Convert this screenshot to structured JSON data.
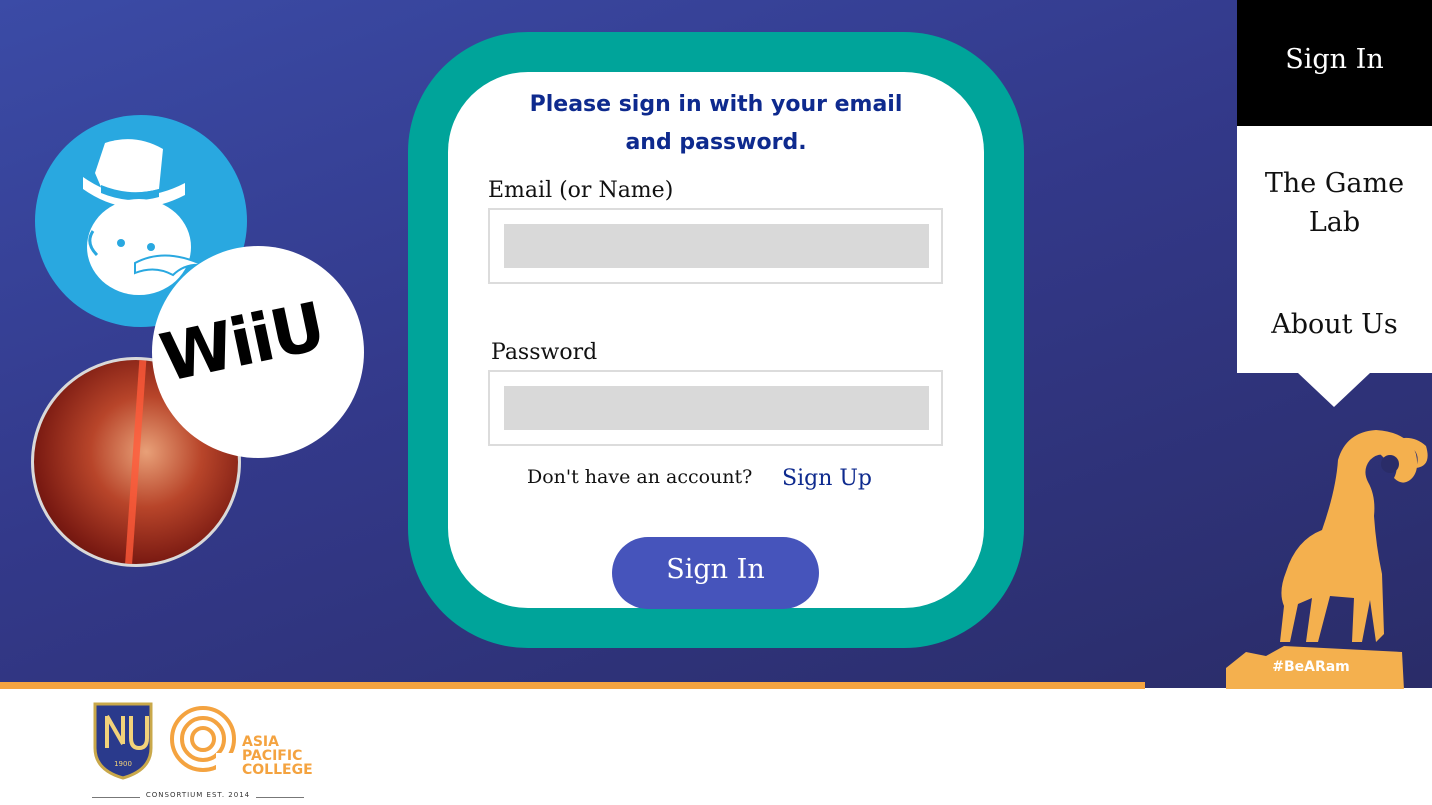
{
  "form": {
    "title_line1": "Please sign in with your email",
    "title_line2": "and password.",
    "email_label": "Email (or Name)",
    "email_value": "",
    "password_label": "Password",
    "password_value": "",
    "no_account_text": "Don't have an account?",
    "signup_link": "Sign Up",
    "signin_button": "Sign In"
  },
  "nav": {
    "active_item": "Sign In",
    "items": [
      "The Game Lab",
      "About Us"
    ]
  },
  "branding": {
    "hashtag": "#BeARam",
    "nu_year": "1900",
    "apc_line1": "ASIA",
    "apc_line2": "PACIFIC",
    "apc_line3": "COLLEGE",
    "consortium": "CONSORTIUM EST. 2014",
    "wii_logo": "WiiU"
  },
  "colors": {
    "background": "#33398a",
    "card_border": "#00a49a",
    "accent_orange": "#f4a340",
    "button": "#4654bb",
    "title": "#0e2a8e"
  },
  "icons": [
    "monopoly-man-icon",
    "wiiu-logo-icon",
    "tekken-image-icon",
    "ram-mascot-icon",
    "nu-crest-icon",
    "apc-logo-icon"
  ]
}
